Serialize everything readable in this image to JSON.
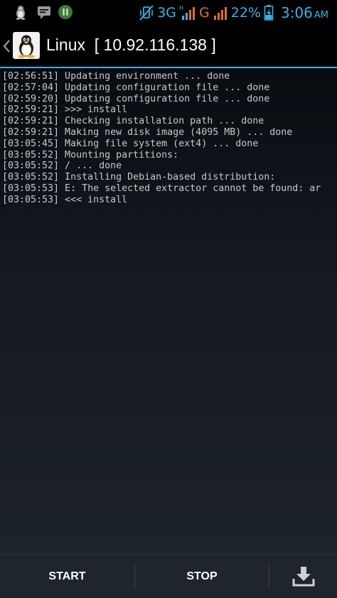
{
  "status_bar": {
    "icons_left": [
      "linux-tux-icon",
      "chat-icon",
      "wakelock-icon"
    ],
    "icons_right": [
      "vibrate-off-icon",
      "signal-3g-icon",
      "signal-g-icon",
      "battery-charging-icon"
    ],
    "network_3g": "3G",
    "network_g": "G",
    "battery_percent": "22%",
    "time": "3:06",
    "ampm": "AM",
    "accent_color": "#33b5e5"
  },
  "action_bar": {
    "title": "Linux  [ 10.92.116.138 ]",
    "app_icon": "linux-tux-icon",
    "accent_color": "#33b5e5"
  },
  "log": {
    "lines": [
      "[02:56:51] Updating environment ... done",
      "[02:57:04] Updating configuration file ... done",
      "[02:59:20] Updating configuration file ... done",
      "[02:59:21] >>> install",
      "[02:59:21] Checking installation path ... done",
      "[02:59:21] Making new disk image (4095 MB) ... done",
      "[03:05:45] Making file system (ext4) ... done",
      "[03:05:52] Mounting partitions:",
      "[03:05:52] / ... done",
      "[03:05:52] Installing Debian-based distribution:",
      "[03:05:53] E: The selected extractor cannot be found: ar",
      "[03:05:53] <<< install"
    ]
  },
  "bottom_bar": {
    "start_label": "START",
    "stop_label": "STOP",
    "settings_icon": "download-icon"
  }
}
